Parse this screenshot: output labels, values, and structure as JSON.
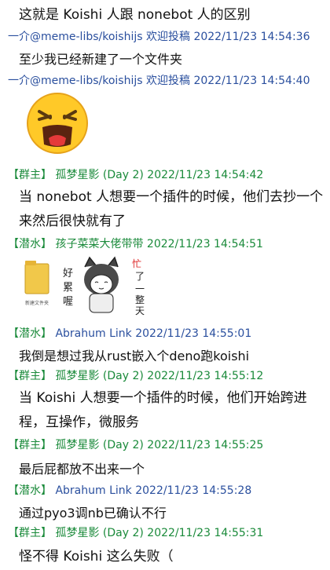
{
  "messages": [
    {
      "kind": "text",
      "text": "这就是 Koishi 人跟 nonebot 人的区别"
    },
    {
      "kind": "header",
      "tag": "",
      "nick": "一介@meme-libs/koishijs",
      "extra": "欢迎投稿",
      "time": "2022/11/23 14:54:36"
    },
    {
      "kind": "text",
      "text": "至少我已经新建了一个文件夹"
    },
    {
      "kind": "header",
      "tag": "",
      "nick": "一介@meme-libs/koishijs",
      "extra": "欢迎投稿",
      "time": "2022/11/23 14:54:40"
    },
    {
      "kind": "header",
      "tag": "【群主】",
      "nick": "孤梦星影",
      "extra": "(Day 2)",
      "time": "2022/11/23 14:54:42"
    },
    {
      "kind": "text",
      "text": "当 nonebot 人想要一个插件的时候，他们去抄一个来然后很快就有了"
    },
    {
      "kind": "header",
      "tag": "【潜水】",
      "nick": "孩子菜菜大佬带带",
      "extra": "",
      "time": "2022/11/23 14:54:51"
    },
    {
      "kind": "header",
      "tag": "【潜水】",
      "nick": "Abrahum Link",
      "extra": "",
      "time": "2022/11/23 14:55:01"
    },
    {
      "kind": "text",
      "text": "我倒是想过我从rust嵌入个deno跑koishi"
    },
    {
      "kind": "header",
      "tag": "【群主】",
      "nick": "孤梦星影",
      "extra": "(Day 2)",
      "time": "2022/11/23 14:55:12"
    },
    {
      "kind": "text",
      "text": "当 Koishi 人想要一个插件的时候，他们开始跨进程，互操作，微服务"
    },
    {
      "kind": "header",
      "tag": "【群主】",
      "nick": "孤梦星影",
      "extra": "(Day 2)",
      "time": "2022/11/23 14:55:25"
    },
    {
      "kind": "text",
      "text": "最后屁都放不出来一个"
    },
    {
      "kind": "header",
      "tag": "【潜水】",
      "nick": "Abrahum Link",
      "extra": "",
      "time": "2022/11/23 14:55:28"
    },
    {
      "kind": "text",
      "text": "通过pyo3调nb已确认不行"
    },
    {
      "kind": "header",
      "tag": "【群主】",
      "nick": "孤梦星影",
      "extra": "(Day 2)",
      "time": "2022/11/23 14:55:31"
    },
    {
      "kind": "text",
      "text": "怪不得 Koishi 这么失败（"
    }
  ],
  "sticker": {
    "folder_caption": "新建文件夹",
    "text_left": "好累喔",
    "text_right": "忙了一整天"
  }
}
